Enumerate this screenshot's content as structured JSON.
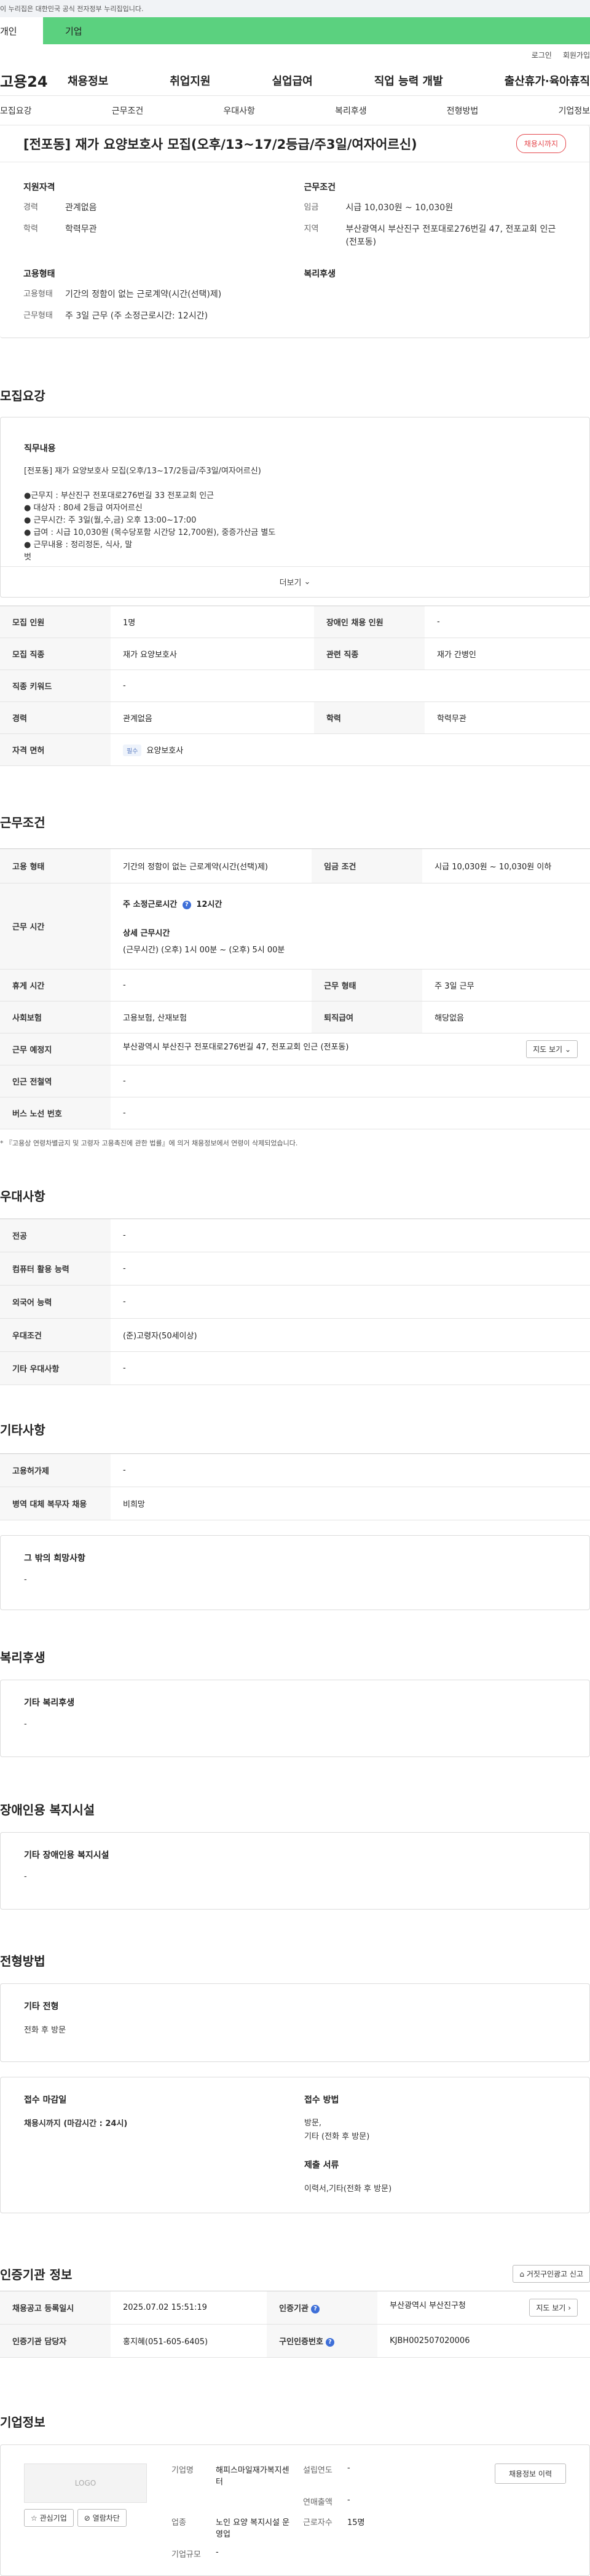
{
  "topbar": {
    "notice": "이 누리집은 대한민국 공식 전자정부 누리집입니다."
  },
  "user_tabs": {
    "personal": "개인",
    "company": "기업"
  },
  "util": {
    "login": "로그인",
    "join": "회원가입"
  },
  "gnb": {
    "logo": "고용24",
    "menu": [
      "채용정보",
      "취업지원",
      "실업급여",
      "직업 능력 개발",
      "출산휴가·육아휴직"
    ]
  },
  "subnav": [
    "모집요강",
    "근무조건",
    "우대사항",
    "복리후생",
    "전형방법",
    "기업정보"
  ],
  "job": {
    "title": "[전포동] 재가 요양보호사 모집(오후/13~17/2등급/주3일/여자어르신)",
    "status_badge": "채용시까지",
    "qual": {
      "heading": "지원자격",
      "career_k": "경력",
      "career_v": "관계없음",
      "edu_k": "학력",
      "edu_v": "학력무관"
    },
    "cond": {
      "heading": "근무조건",
      "wage_k": "임금",
      "wage_v": "시급 10,030원 ~ 10,030원",
      "loc_k": "지역",
      "loc_v": "부산광역시 부산진구 전포대로276번길 47, 전포교회 인근 (전포동)"
    },
    "emp": {
      "heading": "고용형태",
      "type_k": "고용형태",
      "type_v": "기간의 정함이 없는 근로계약(시간(선택)제)",
      "hours_k": "근무형태",
      "hours_v": "주 3일 근무 (주 소정근로시간: 12시간)"
    },
    "welfare": {
      "heading": "복리후생"
    }
  },
  "recruit": {
    "section_title": "모집요강",
    "duty_heading": "직무내용",
    "lines": [
      "[전포동] 재가 요양보호사 모집(오후/13~17/2등급/주3일/여자어르신)",
      "",
      "●근무지 : 부산진구 전포대로276번길 33 전포교회 인근",
      "● 대상자 : 80세 2등급 여자어르신",
      "● 근무시간: 주 3일(월,수,금) 오후 13:00~17:00",
      "● 급여 : 시급 10,030원 (목수당포함 시간당 12,700원), 중증가산금 별도",
      "● 근무내용 : 정리정돈, 식사, 말",
      "벗"
    ],
    "more": "더보기"
  },
  "recruit_table": {
    "rows": [
      {
        "k1": "모집 인원",
        "v1": "1명",
        "k2": "장애인 채용 인원",
        "v2": "-"
      },
      {
        "k1": "모집 직종",
        "v1": "재가 요양보호사",
        "k2": "관련 직종",
        "v2": "재가 간병인"
      },
      {
        "k1": "직종 키워드",
        "v1": "-"
      },
      {
        "k1": "경력",
        "v1": "관계없음",
        "k2": "학력",
        "v2": "학력무관"
      },
      {
        "k1": "자격 면허",
        "chip": "필수",
        "v1": "요양보호사"
      }
    ]
  },
  "work": {
    "section_title": "근무조건",
    "emp_k": "고용 형태",
    "emp_v": "기간의 정함이 없는 근로계약(시간(선택)제)",
    "wage_k": "임금 조건",
    "wage_v": "시급 10,030원 ~ 10,030원 이하",
    "time_k": "근무 시간",
    "weekly_label": "주 소정근로시간",
    "weekly_v": "12시간",
    "detail_label": "상세 근무시간",
    "detail_v": "(근무시간) (오후) 1시 00분 ~ (오후) 5시 00분",
    "rest_k": "휴게 시간",
    "rest_v": "-",
    "form_k": "근무 형태",
    "form_v": "주 3일 근무",
    "ins_k": "사회보험",
    "ins_v": "고용보험, 산재보험",
    "ret_k": "퇴직급여",
    "ret_v": "해당없음",
    "place_k": "근무 예정지",
    "place_v": "부산광역시 부산진구 전포대로276번길 47, 전포교회 인근 (전포동)",
    "map_btn": "지도 보기",
    "subway_k": "인근 전철역",
    "subway_v": "-",
    "bus_k": "버스 노선 번호",
    "bus_v": "-",
    "note": "* 『고용상 연령차별금지 및 고령자 고용촉진에 관한 법률』에 의거 채용정보에서 연령이 삭제되었습니다."
  },
  "pref": {
    "section_title": "우대사항",
    "rows": [
      {
        "k": "전공",
        "v": "-"
      },
      {
        "k": "컴퓨터 활용 능력",
        "v": "-"
      },
      {
        "k": "외국어 능력",
        "v": "-"
      },
      {
        "k": "우대조건",
        "v": "(준)고령자(50세이상)"
      },
      {
        "k": "기타 우대사항",
        "v": "-"
      }
    ]
  },
  "etc": {
    "section_title": "기타사항",
    "rows": [
      {
        "k": "고용허가제",
        "v": "-"
      },
      {
        "k": "병역 대체 복무자 채용",
        "v": "비희망"
      }
    ],
    "hope_heading": "그 밖의 희망사항",
    "hope_v": "-"
  },
  "benefit": {
    "section_title": "복리후생",
    "heading": "기타 복리후생",
    "v": "-"
  },
  "disability": {
    "section_title": "장애인용 복지시설",
    "heading": "기타 장애인용 복지시설",
    "v": "-"
  },
  "selection": {
    "section_title": "전형방법",
    "other_heading": "기타 전형",
    "other_v": "전화 후 방문",
    "deadline_heading": "접수 마감일",
    "deadline_v": "채용시까지 (마감시간 : 24시)",
    "method_heading": "접수 방법",
    "method_v1": "방문,",
    "method_v2": "기타 (전화 후 방문)",
    "docs_heading": "제출 서류",
    "docs_v": "이력서,기타(전화 후 방문)"
  },
  "cert": {
    "section_title": "인증기관 정보",
    "report_btn": "거짓구인광고 신고",
    "reg_k": "채용공고 등록일시",
    "reg_v": "2025.07.02 15:51:19",
    "org_k": "인증기관",
    "org_v": "부산광역시 부산진구청",
    "map_btn": "지도 보기",
    "staff_k": "인증기관 담당자",
    "staff_v": "홍지혜(051-605-6405)",
    "num_k": "구인인증번호",
    "num_v": "KJBH002507020006"
  },
  "company": {
    "section_title": "기업정보",
    "logo_text": "LOGO",
    "fav_btn": "관심기업",
    "block_btn": "열람차단",
    "name_k": "기업명",
    "name_v": "해피스마일재가복지센터",
    "year_k": "설립연도",
    "year_v": "-",
    "sales_k": "연매출액",
    "sales_v": "-",
    "ind_k": "업종",
    "ind_v": "노인 요양 복지시설 운영업",
    "emp_k": "근로자수",
    "emp_v": "15명",
    "scale_k": "기업규모",
    "scale_v": "-",
    "history_btn": "채용정보 이력"
  }
}
